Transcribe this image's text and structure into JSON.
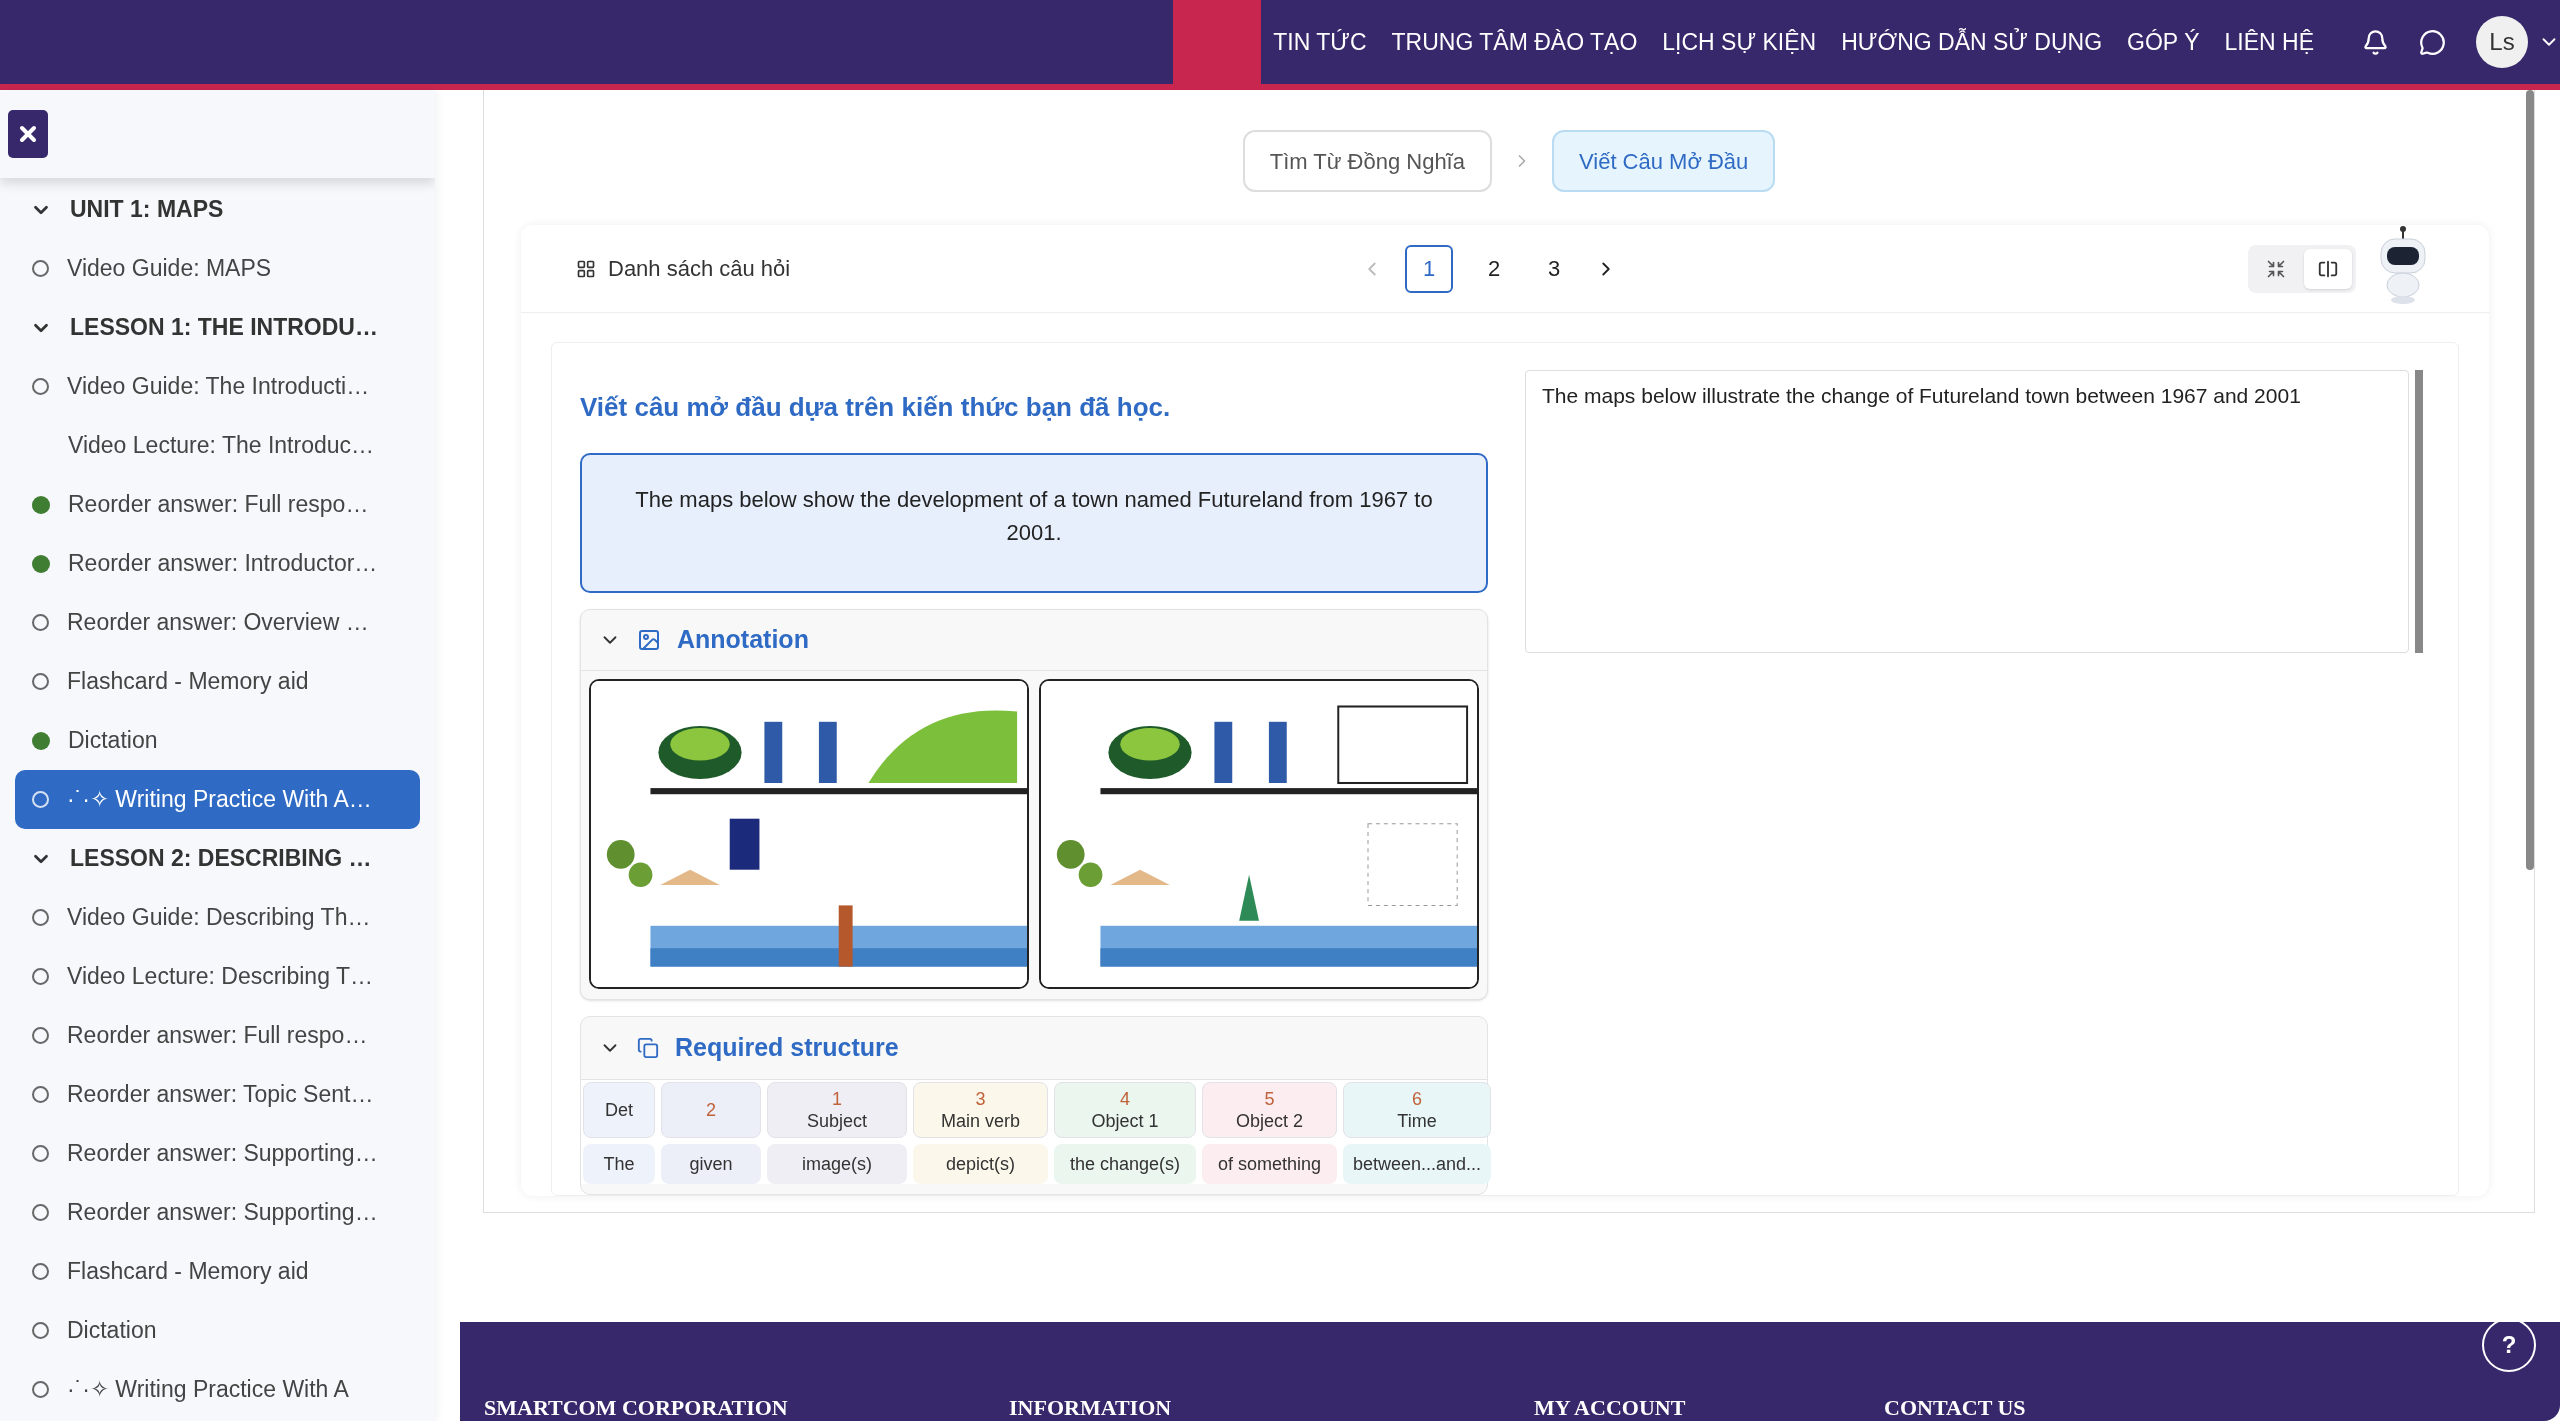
{
  "nav": {
    "links": [
      "TIN TỨC",
      "TRUNG TÂM ĐÀO TẠO",
      "LỊCH SỰ KIỆN",
      "HƯỚNG DẪN SỬ DỤNG",
      "GÓP Ý",
      "LIÊN HỆ"
    ],
    "avatar": "Ls"
  },
  "sidebar": {
    "sections": [
      {
        "title": "UNIT 1: MAPS",
        "expanded": true,
        "items": [
          {
            "label": "Video Guide: MAPS",
            "kind": "todo",
            "selected": false
          }
        ]
      },
      {
        "title": "LESSON 1: THE INTRODU…",
        "expanded": true,
        "items": [
          {
            "label": "Video Guide: The Introducti…",
            "kind": "todo",
            "selected": false
          },
          {
            "label": "Video Lecture: The Introduc…",
            "kind": "plain",
            "selected": false
          },
          {
            "label": "Reorder answer: Full respo…",
            "kind": "done",
            "selected": false
          },
          {
            "label": "Reorder answer: Introductor…",
            "kind": "done",
            "selected": false
          },
          {
            "label": "Reorder answer: Overview …",
            "kind": "todo",
            "selected": false
          },
          {
            "label": "Flashcard - Memory aid",
            "kind": "todo",
            "selected": false
          },
          {
            "label": "Dictation",
            "kind": "done",
            "selected": false
          },
          {
            "label": "·˙·✧ Writing Practice With A…",
            "kind": "todo",
            "selected": true
          }
        ]
      },
      {
        "title": "LESSON 2: DESCRIBING …",
        "expanded": true,
        "items": [
          {
            "label": "Video Guide: Describing Th…",
            "kind": "todo",
            "selected": false
          },
          {
            "label": "Video Lecture: Describing T…",
            "kind": "todo",
            "selected": false
          },
          {
            "label": "Reorder answer: Full respo…",
            "kind": "todo",
            "selected": false
          },
          {
            "label": "Reorder answer: Topic Sent…",
            "kind": "todo",
            "selected": false
          },
          {
            "label": "Reorder answer: Supporting…",
            "kind": "todo",
            "selected": false
          },
          {
            "label": "Reorder answer: Supporting…",
            "kind": "todo",
            "selected": false
          },
          {
            "label": "Flashcard - Memory aid",
            "kind": "todo",
            "selected": false
          },
          {
            "label": "Dictation",
            "kind": "todo",
            "selected": false
          },
          {
            "label": "·˙·✧ Writing Practice With A",
            "kind": "todo",
            "selected": false
          }
        ]
      }
    ]
  },
  "steps": [
    {
      "label": "Tìm Từ Đồng Nghĩa",
      "selected": false
    },
    {
      "label": "Viết Câu Mở Đầu",
      "selected": true
    }
  ],
  "question_list": {
    "label": "Danh sách câu hỏi"
  },
  "pagination": {
    "pages": [
      {
        "label": "1",
        "selected": true
      },
      {
        "label": "2",
        "selected": false
      },
      {
        "label": "3",
        "selected": false
      }
    ]
  },
  "view_toggle": [
    {
      "kind": "shrink",
      "selected": false
    },
    {
      "kind": "split",
      "selected": true
    }
  ],
  "task": {
    "heading": "Viết câu mở đầu dựa trên kiến thức bạn đã học.",
    "prompt": "The maps below show the development of a town named Futureland from 1967 to 2001."
  },
  "annotation": {
    "title": "Annotation",
    "expanded": true
  },
  "structure": {
    "title": "Required structure",
    "expanded": true,
    "columns": [
      {
        "label": "Det",
        "color": "#eef2fb"
      },
      {
        "number": "2",
        "color": "#eceef8"
      },
      {
        "number": "1",
        "label": "Subject",
        "color": "#efeef4"
      },
      {
        "number": "3",
        "label": "Main verb",
        "color": "#fbf7ea"
      },
      {
        "number": "4",
        "label": "Object 1",
        "color": "#eaf6ee"
      },
      {
        "number": "5",
        "label": "Object 2",
        "color": "#fcedf0"
      },
      {
        "number": "6",
        "label": "Time",
        "color": "#e8f6f8"
      }
    ],
    "row": [
      "The",
      "given",
      "image(s)",
      "depict(s)",
      "the change(s)",
      "of something",
      "between...and..."
    ]
  },
  "answer": {
    "value": "The maps below illustrate the change of Futureland town between 1967 and 2001"
  },
  "footer": {
    "help": "?",
    "headings": [
      "SMARTCOM CORPORATION",
      "INFORMATION",
      "MY ACCOUNT",
      "CONTACT US"
    ]
  }
}
